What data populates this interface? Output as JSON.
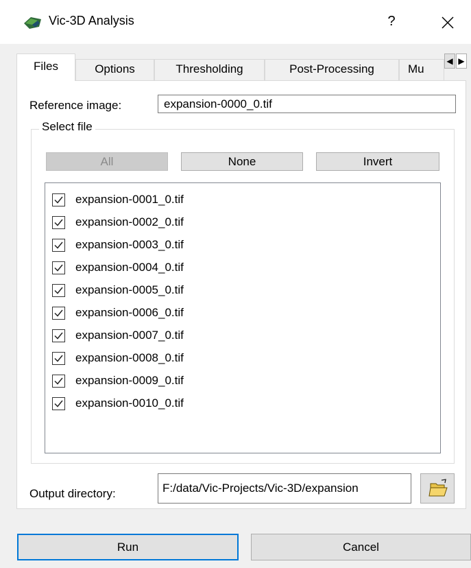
{
  "window": {
    "title": "Vic-3D Analysis",
    "help_label": "?",
    "app_icon": "vic3d-logo-icon",
    "close_icon": "close-icon"
  },
  "tabs": [
    {
      "label": "Files",
      "active": true
    },
    {
      "label": "Options",
      "active": false
    },
    {
      "label": "Thresholding",
      "active": false
    },
    {
      "label": "Post-Processing",
      "active": false
    },
    {
      "label": "Mu",
      "active": false
    }
  ],
  "files": {
    "reference_label": "Reference image:",
    "reference_value": "expansion-0000_0.tif",
    "select_group_title": "Select file",
    "buttons": {
      "all": "All",
      "none": "None",
      "invert": "Invert"
    },
    "items": [
      {
        "name": "expansion-0001_0.tif",
        "checked": true
      },
      {
        "name": "expansion-0002_0.tif",
        "checked": true
      },
      {
        "name": "expansion-0003_0.tif",
        "checked": true
      },
      {
        "name": "expansion-0004_0.tif",
        "checked": true
      },
      {
        "name": "expansion-0005_0.tif",
        "checked": true
      },
      {
        "name": "expansion-0006_0.tif",
        "checked": true
      },
      {
        "name": "expansion-0007_0.tif",
        "checked": true
      },
      {
        "name": "expansion-0008_0.tif",
        "checked": true
      },
      {
        "name": "expansion-0009_0.tif",
        "checked": true
      },
      {
        "name": "expansion-0010_0.tif",
        "checked": true
      }
    ],
    "output_label": "Output directory:",
    "output_value": "F:/data/Vic-Projects/Vic-3D/expansion",
    "folder_icon": "open-folder-icon"
  },
  "footer": {
    "run_label": "Run",
    "cancel_label": "Cancel"
  },
  "colors": {
    "focus_border": "#0078d7",
    "button_bg": "#e1e1e1",
    "dialog_bg": "#f0f0f0"
  }
}
